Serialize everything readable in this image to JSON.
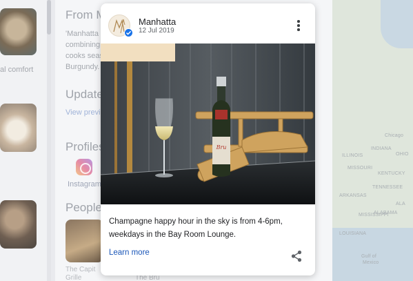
{
  "background": {
    "section_from_heading": "From M",
    "section_from_text": [
      "'Manhatta is",
      "combining",
      "cooks seas",
      "Burgundy."
    ],
    "left_caption": "al comfort",
    "updates_heading": "Updates",
    "updates_link": "View previ",
    "profiles_heading": "Profiles",
    "instagram_label": "Instagram",
    "people_heading": "People",
    "people_caption_1": "The Capit",
    "people_caption_2": "Grille",
    "people_caption_3": "The Bru",
    "map_labels": [
      "Chicago",
      "MISSOURI",
      "TENNESSEE",
      "ARKANSAS",
      "MISSISSIPPI",
      "Gulf of",
      "Mexico",
      "INDIANA",
      "OHIO",
      "ILLINOIS",
      "KENTUCKY",
      "ALABAMA",
      "ALA",
      "LOUISIANA"
    ]
  },
  "post": {
    "author": "Manhatta",
    "date": "12 Jul 2019",
    "caption": "Champagne happy hour in the sky is from 4-6pm, weekdays in the Bay Room Lounge.",
    "learn_more": "Learn more",
    "icons": {
      "avatar": "manhatta-logo",
      "verified": "verified-check-icon",
      "more": "more-vert-icon",
      "share": "share-icon"
    },
    "colors": {
      "link": "#1a56b8",
      "verified": "#1a73e8"
    }
  }
}
